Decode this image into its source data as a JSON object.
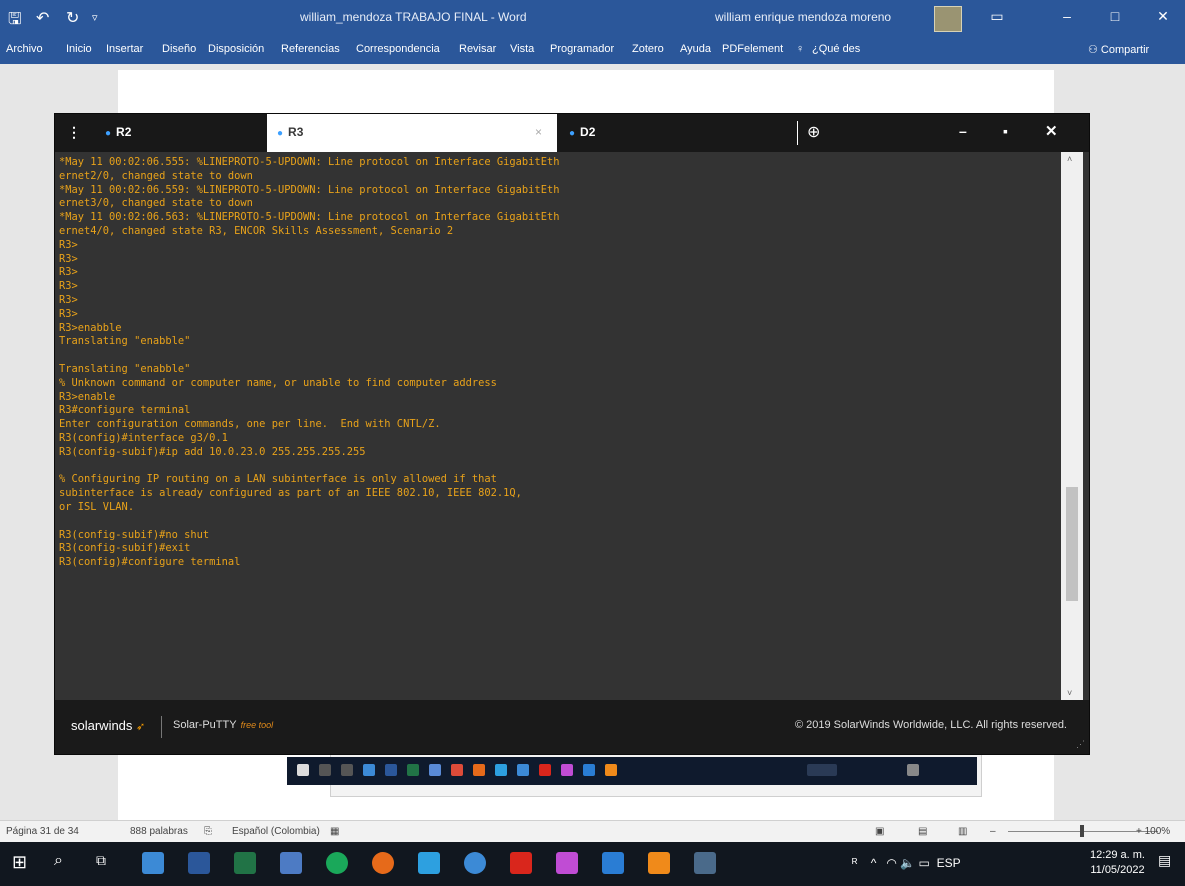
{
  "word": {
    "document_title": "william_mendoza TRABAJO FINAL  -  Word",
    "user_name": "william enrique mendoza moreno",
    "ribbon_tabs": [
      "Archivo",
      "Inicio",
      "Insertar",
      "Diseño",
      "Disposición",
      "Referencias",
      "Correspondencia",
      "Revisar",
      "Vista",
      "Programador",
      "Zotero",
      "Ayuda",
      "PDFelement",
      "¿Qué des",
      "Compartir"
    ],
    "status": {
      "page": "Página 31 de 34",
      "words": "888 palabras",
      "language": "Español (Colombia)",
      "zoom": "+ 100%"
    }
  },
  "putty": {
    "tabs": [
      {
        "label": "R2",
        "active": false
      },
      {
        "label": "R3",
        "active": true
      },
      {
        "label": "D2",
        "active": false
      }
    ],
    "close_tab_glyph": "×",
    "new_tab_glyph": "⊕",
    "brand": "solarwinds",
    "product": "Solar-PuTTY",
    "product_tag": "free tool",
    "copyright": "© 2019 SolarWinds Worldwide, LLC. All rights reserved.",
    "terminal_text": "*May 11 00:02:06.555: %LINEPROTO-5-UPDOWN: Line protocol on Interface GigabitEth\nernet2/0, changed state to down\n*May 11 00:02:06.559: %LINEPROTO-5-UPDOWN: Line protocol on Interface GigabitEth\nernet3/0, changed state to down\n*May 11 00:02:06.563: %LINEPROTO-5-UPDOWN: Line protocol on Interface GigabitEth\nernet4/0, changed state R3, ENCOR Skills Assessment, Scenario 2\nR3>\nR3>\nR3>\nR3>\nR3>\nR3>\nR3>enabble\nTranslating \"enabble\"\n\nTranslating \"enabble\"\n% Unknown command or computer name, or unable to find computer address\nR3>enable\nR3#configure terminal\nEnter configuration commands, one per line.  End with CNTL/Z.\nR3(config)#interface g3/0.1\nR3(config-subif)#ip add 10.0.23.0 255.255.255.255\n\n% Configuring IP routing on a LAN subinterface is only allowed if that\nsubinterface is already configured as part of an IEEE 802.10, IEEE 802.1Q,\nor ISL VLAN.\n\nR3(config-subif)#no shut\nR3(config-subif)#exit\nR3(config)#configure terminal"
  },
  "taskbar": {
    "time": "12:29 a. m.",
    "date": "11/05/2022",
    "language": "ESP"
  },
  "colors": {
    "word_blue": "#2b579a",
    "terminal_bg": "#333333",
    "terminal_text": "#e8a21a",
    "tab_dot": "#3da0ff"
  }
}
